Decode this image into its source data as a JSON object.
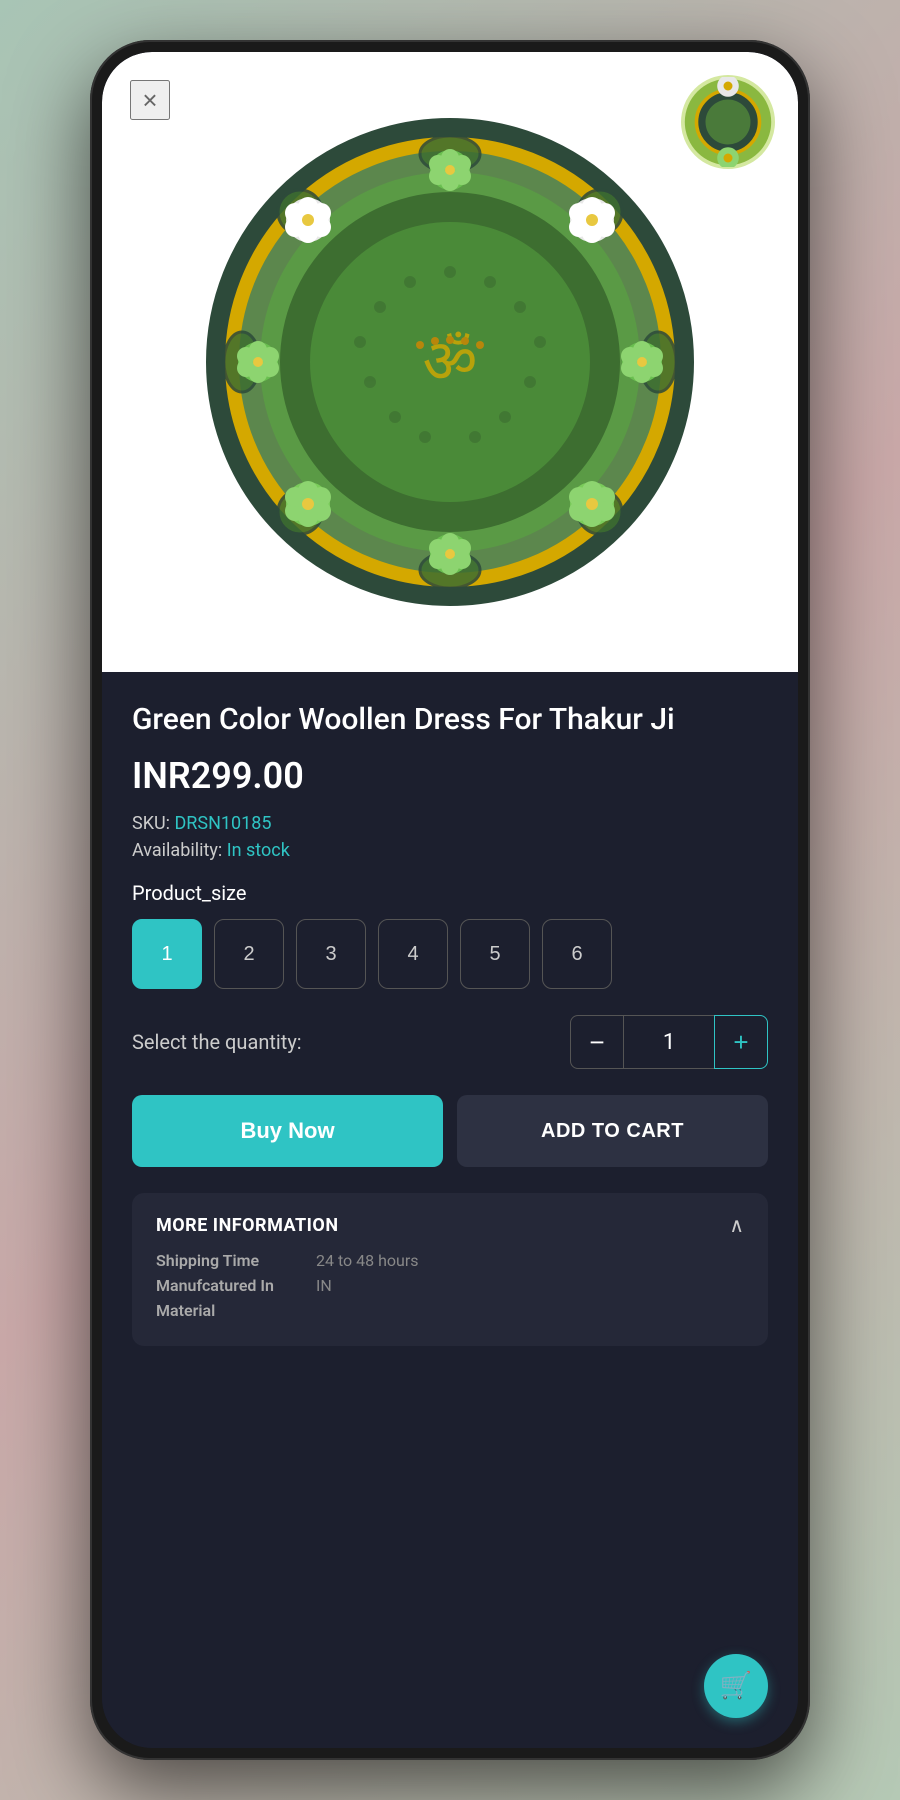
{
  "phone": {
    "close_label": "×",
    "product": {
      "title": "Green Color Woollen Dress For Thakur Ji",
      "price": "INR299.00",
      "sku_label": "SKU:",
      "sku_value": "DRSN10185",
      "availability_label": "Availability:",
      "availability_value": "In stock",
      "size_label": "Product_size",
      "sizes": [
        "1",
        "2",
        "3",
        "4",
        "5",
        "6"
      ],
      "active_size_index": 0,
      "quantity_label": "Select the quantity:",
      "quantity_value": "1",
      "buy_now_label": "Buy Now",
      "add_to_cart_label": "ADD TO CART",
      "more_info_title": "MORE INFORMATION",
      "more_info_items": [
        {
          "key": "Shipping Time",
          "value": "24 to 48 hours"
        },
        {
          "key": "Manufcatured In",
          "value": "IN"
        },
        {
          "key": "Material",
          "value": ""
        }
      ]
    },
    "fab_icon": "🛒"
  }
}
